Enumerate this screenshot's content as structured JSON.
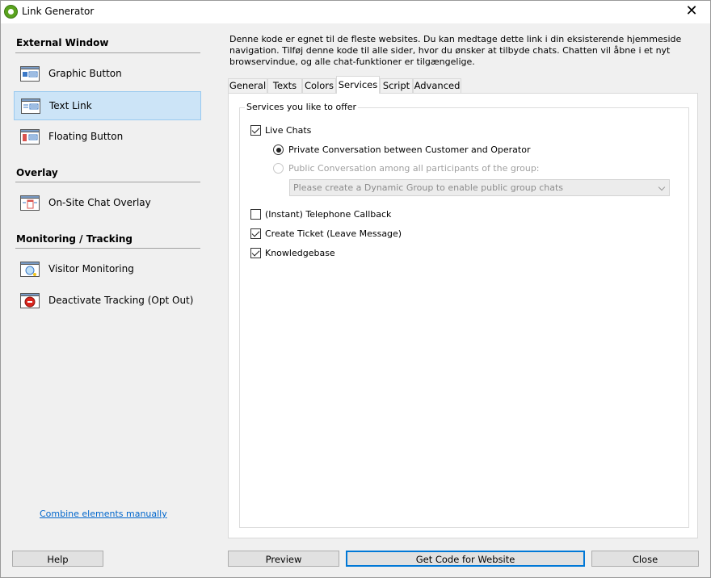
{
  "window": {
    "title": "Link Generator",
    "close_glyph": "✕"
  },
  "sidebar": {
    "sections": [
      {
        "title": "External Window"
      },
      {
        "title": "Overlay"
      },
      {
        "title": "Monitoring / Tracking"
      }
    ],
    "items": [
      {
        "label": "Graphic Button",
        "icon": "graphic-button-icon"
      },
      {
        "label": "Text Link",
        "icon": "text-link-icon",
        "selected": true
      },
      {
        "label": "Floating Button",
        "icon": "floating-button-icon"
      },
      {
        "label": "On-Site Chat Overlay",
        "icon": "chat-overlay-icon"
      },
      {
        "label": "Visitor Monitoring",
        "icon": "visitor-monitoring-icon"
      },
      {
        "label": "Deactivate Tracking (Opt Out)",
        "icon": "opt-out-icon"
      }
    ],
    "combine_link": "Combine elements manually"
  },
  "main": {
    "description": "Denne kode er egnet til de fleste websites. Du kan medtage dette link i din eksisterende hjemmeside navigation. Tilføj denne kode til alle sider, hvor du ønsker at tilbyde chats. Chatten vil åbne i et nyt browservindue, og alle chat-funktioner er tilgængelige.",
    "tabs": [
      {
        "label": "General"
      },
      {
        "label": "Texts"
      },
      {
        "label": "Colors"
      },
      {
        "label": "Services",
        "active": true
      },
      {
        "label": "Script"
      },
      {
        "label": "Advanced"
      }
    ],
    "services": {
      "group_title": "Services you like to offer",
      "live_chats": "Live Chats",
      "private_conversation": "Private Conversation between Customer and Operator",
      "public_conversation": "Public Conversation among all participants of the group:",
      "group_select_placeholder": "Please create a Dynamic Group to enable public group chats",
      "telephone_callback": "(Instant) Telephone Callback",
      "create_ticket": "Create Ticket (Leave Message)",
      "knowledgebase": "Knowledgebase",
      "checked": {
        "live_chats": true,
        "telephone_callback": false,
        "create_ticket": true,
        "knowledgebase": true
      },
      "radio_selected": "private"
    }
  },
  "footer": {
    "help": "Help",
    "preview": "Preview",
    "get_code": "Get Code for Website",
    "close": "Close"
  },
  "colors": {
    "selection_bg": "#cce4f7",
    "selection_border": "#99c9ef",
    "link": "#0066cc",
    "default_button_border": "#0078d7"
  }
}
